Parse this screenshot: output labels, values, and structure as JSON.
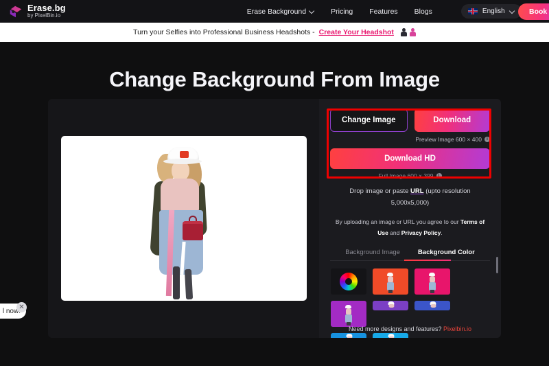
{
  "navbar": {
    "brand_title": "Erase.bg",
    "brand_sub": "by PixelBin.io",
    "links": [
      {
        "label": "Erase Background",
        "has_chevron": true
      },
      {
        "label": "Pricing",
        "has_chevron": false
      },
      {
        "label": "Features",
        "has_chevron": false
      },
      {
        "label": "Blogs",
        "has_chevron": false
      }
    ],
    "language": "English",
    "book_button": "Book a"
  },
  "promo": {
    "text": "Turn your Selfies into Professional Business Headshots -",
    "link": "Create Your Headshot"
  },
  "heading": "Change Background From Image",
  "panel": {
    "change_image_button": "Change Image",
    "download_button": "Download",
    "preview_note": "Preview Image 600 × 400",
    "download_hd_button": "Download HD",
    "full_note": "Full Image 600 × 399",
    "drop_text_before": "Drop image or paste ",
    "drop_url_link": "URL",
    "drop_text_after": " (upto resolution",
    "drop_resolution": "5,000x5,000)",
    "terms_line1_before": "By uploading an image or URL you agree to our ",
    "terms_line1_bold": "Terms of",
    "terms_line2_bold1": "Use",
    "terms_line2_mid": " and ",
    "terms_line2_bold2": "Privacy Policy",
    "terms_line2_end": ".",
    "tabs": [
      {
        "label": "Background Image",
        "active": false
      },
      {
        "label": "Background Color",
        "active": true
      }
    ],
    "swatches_row1": [
      "color-picker",
      "#F04B28",
      "#E8156B",
      "#A32BC4"
    ],
    "swatches_row2": [
      "#7B3FC4",
      "#3B55C9",
      "#1792E0",
      "#17A9E8"
    ],
    "need_more_text": "Need more designs and features? ",
    "need_more_link": "Pixelbin.io"
  },
  "chat": {
    "bubble_text": "l now!",
    "close_icon": "close-icon"
  },
  "colors": {
    "accent_gradient_start": "#FF4040",
    "accent_gradient_mid": "#F0307B",
    "accent_gradient_end": "#B23BD6",
    "promo_link": "#E8186F",
    "annotation_box": "#EE0000",
    "page_background": "#0F0F10",
    "panel_background": "#1B1B1F"
  }
}
